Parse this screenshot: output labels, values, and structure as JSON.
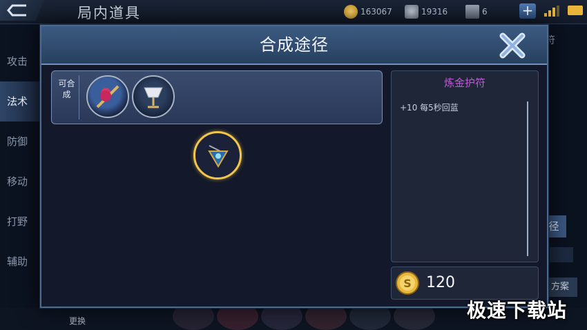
{
  "background": {
    "title": "局内道具",
    "resources": [
      {
        "icon": "gold-coin-icon",
        "value": "163067"
      },
      {
        "icon": "diamond-icon",
        "value": "19316"
      },
      {
        "icon": "ticket-icon",
        "value": "6"
      }
    ],
    "sidebar": [
      "攻击",
      "法术",
      "防御",
      "移动",
      "打野",
      "辅助"
    ],
    "active_sidebar": "法术",
    "bottom_button": "更换",
    "right_top": "符",
    "right_button": "径",
    "right_plan": "方案"
  },
  "modal": {
    "title": "合成途径",
    "synth_label": "可合成",
    "synth_items": [
      "staff-item-icon",
      "goblet-item-icon"
    ],
    "center_item": "amulet-item-icon",
    "detail": {
      "name": "炼金护符",
      "stat": "+10 每5秒回蓝"
    },
    "price": "120"
  },
  "watermark": "极速下载站",
  "colors": {
    "item_name": "#c15ad6",
    "selection_ring": "#f1c64a",
    "header": "#3c5a82"
  }
}
